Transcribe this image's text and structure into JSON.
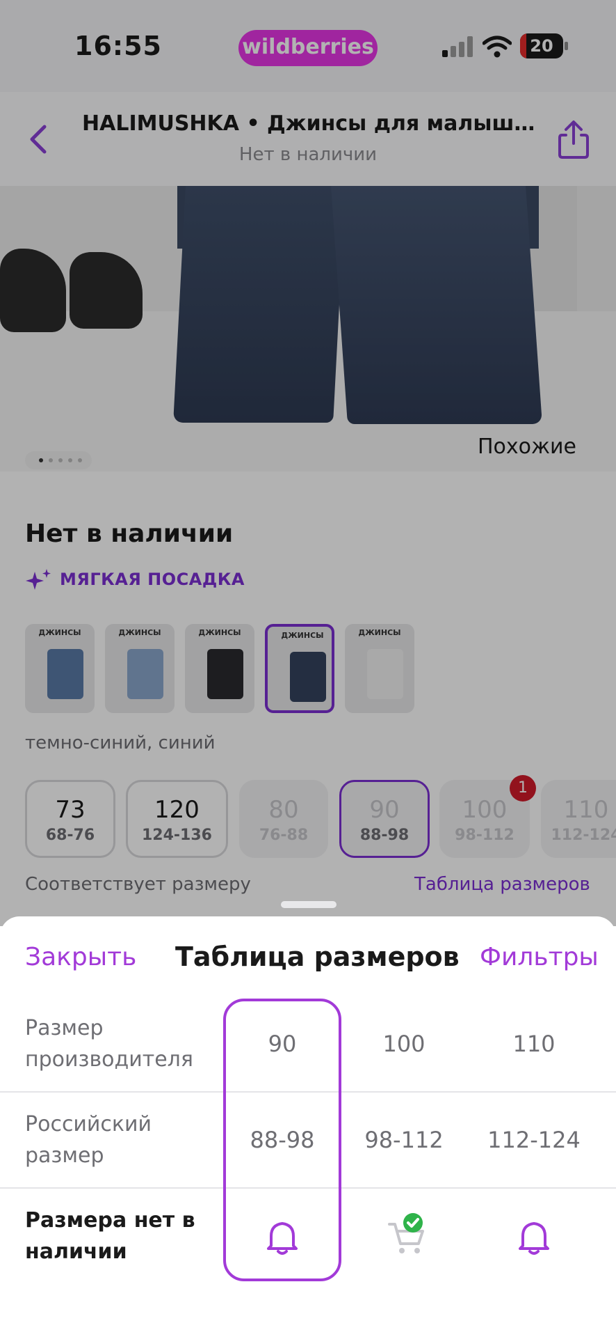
{
  "status_bar": {
    "time": "16:55",
    "brand": "wildberries",
    "battery": "20",
    "brand_color": "#e636e4"
  },
  "header": {
    "title": "HALIMUSHKA • Джинсы для малышей с...",
    "subtitle": "Нет в наличии",
    "back_icon": "chevron-left-icon",
    "share_icon": "share-icon"
  },
  "gallery": {
    "similar_button": "Похожие",
    "pages": 5,
    "current_page": 1
  },
  "product": {
    "stock_status": "Нет в наличии",
    "feature_label": "МЯГКАЯ ПОСАДКА",
    "color_name": "темно-синий, синий",
    "thumbnail_caption": "ДЖИНСЫ",
    "selected_thumbnail": 4
  },
  "sizes": [
    {
      "size": "73",
      "ru": "68-76",
      "available": true
    },
    {
      "size": "120",
      "ru": "124-136",
      "available": true
    },
    {
      "size": "80",
      "ru": "76-88",
      "available": false
    },
    {
      "size": "90",
      "ru": "88-98",
      "available": false,
      "selected": true
    },
    {
      "size": "100",
      "ru": "98-112",
      "available": false
    },
    {
      "size": "110",
      "ru": "112-124",
      "available": false
    }
  ],
  "notification_badge": "1",
  "fit_label": "Соответствует размеру",
  "size_table_link": "Таблица размеров",
  "sheet": {
    "close": "Закрыть",
    "title": "Таблица размеров",
    "filters": "Фильтры",
    "rows": [
      {
        "label_line1": "Размер",
        "label_line2": "производителя",
        "values": [
          "90",
          "100",
          "110"
        ]
      },
      {
        "label_line1": "Российский",
        "label_line2": "размер",
        "values": [
          "88-98",
          "98-112",
          "112-124"
        ]
      },
      {
        "label_line1": "Размера нет в",
        "label_line2": "наличии",
        "icons": [
          "bell-icon",
          "cart-check-icon",
          "bell-icon"
        ]
      }
    ],
    "accent": "#a23ad8"
  }
}
